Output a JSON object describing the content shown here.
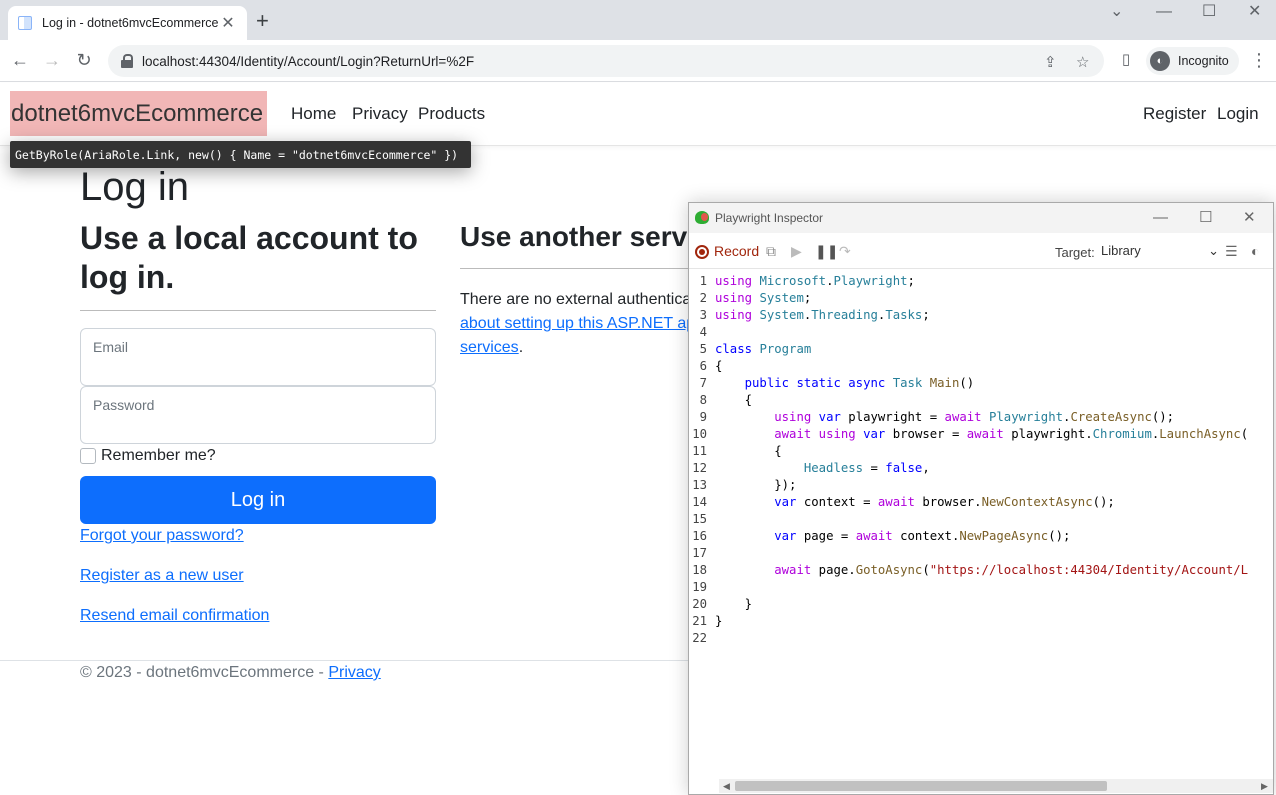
{
  "browser": {
    "tab_title": "Log in - dotnet6mvcEcommerce",
    "tab_close": "✕",
    "new_tab": "+",
    "url": "localhost:44304/Identity/Account/Login?ReturnUrl=%2F",
    "profile_label": "Incognito",
    "win_controls": [
      "⌄",
      "—",
      "☐",
      "✕"
    ],
    "nav_icons": [
      "arrow-back-icon",
      "arrow-forward-icon",
      "reload-icon"
    ]
  },
  "site": {
    "brand": "dotnet6mvcEcommerce",
    "nav": {
      "home": "Home",
      "privacy": "Privacy",
      "products": "Products",
      "register": "Register",
      "login": "Login"
    },
    "highlight_tooltip": "GetByRole(AriaRole.Link, new() { Name = \"dotnet6mvcEcommerce\" })"
  },
  "login": {
    "title": "Log in",
    "subtitle": "Use a local account to log in.",
    "email_label": "Email",
    "password_label": "Password",
    "remember_label": "Remember me?",
    "submit_label": "Log in",
    "forgot_link": "Forgot your password?",
    "register_link": "Register as a new user",
    "resend_link": "Resend email confirmation"
  },
  "external": {
    "title": "Use another servic",
    "text_line1": "There are no external authentica",
    "link_line2": "about setting up this ASP.NET ap",
    "link_line3": "services",
    "line3_suffix": "."
  },
  "footer": {
    "copyright": "© 2023 - dotnet6mvcEcommerce - ",
    "privacy_link": "Privacy"
  },
  "inspector": {
    "title": "Playwright Inspector",
    "record_label": "Record",
    "target_label": "Target:",
    "target_value": "Library",
    "code_lines": [
      [
        [
          "kw",
          "using"
        ],
        [
          "ct",
          " "
        ],
        [
          "ty",
          "Microsoft"
        ],
        [
          "ct",
          "."
        ],
        [
          "ty",
          "Playwright"
        ],
        [
          "ct",
          ";"
        ]
      ],
      [
        [
          "kw",
          "using"
        ],
        [
          "ct",
          " "
        ],
        [
          "ty",
          "System"
        ],
        [
          "ct",
          ";"
        ]
      ],
      [
        [
          "kw",
          "using"
        ],
        [
          "ct",
          " "
        ],
        [
          "ty",
          "System"
        ],
        [
          "ct",
          "."
        ],
        [
          "ty",
          "Threading"
        ],
        [
          "ct",
          "."
        ],
        [
          "ty",
          "Tasks"
        ],
        [
          "ct",
          ";"
        ]
      ],
      [],
      [
        [
          "kb",
          "class"
        ],
        [
          "ct",
          " "
        ],
        [
          "ty",
          "Program"
        ]
      ],
      [
        [
          "ct",
          "{"
        ]
      ],
      [
        [
          "ct",
          "    "
        ],
        [
          "kb",
          "public"
        ],
        [
          "ct",
          " "
        ],
        [
          "kb",
          "static"
        ],
        [
          "ct",
          " "
        ],
        [
          "kb",
          "async"
        ],
        [
          "ct",
          " "
        ],
        [
          "ty",
          "Task"
        ],
        [
          "ct",
          " "
        ],
        [
          "fn",
          "Main"
        ],
        [
          "ct",
          "()"
        ]
      ],
      [
        [
          "ct",
          "    {"
        ]
      ],
      [
        [
          "ct",
          "        "
        ],
        [
          "kw",
          "using"
        ],
        [
          "ct",
          " "
        ],
        [
          "kb",
          "var"
        ],
        [
          "ct",
          " playwright = "
        ],
        [
          "kw",
          "await"
        ],
        [
          "ct",
          " "
        ],
        [
          "ty",
          "Playwright"
        ],
        [
          "ct",
          "."
        ],
        [
          "fn",
          "CreateAsync"
        ],
        [
          "ct",
          "();"
        ]
      ],
      [
        [
          "ct",
          "        "
        ],
        [
          "kw",
          "await"
        ],
        [
          "ct",
          " "
        ],
        [
          "kw",
          "using"
        ],
        [
          "ct",
          " "
        ],
        [
          "kb",
          "var"
        ],
        [
          "ct",
          " browser = "
        ],
        [
          "kw",
          "await"
        ],
        [
          "ct",
          " playwright."
        ],
        [
          "ty",
          "Chromium"
        ],
        [
          "ct",
          "."
        ],
        [
          "fn",
          "LaunchAsync"
        ],
        [
          "ct",
          "("
        ]
      ],
      [
        [
          "ct",
          "        {"
        ]
      ],
      [
        [
          "ct",
          "            "
        ],
        [
          "ty",
          "Headless"
        ],
        [
          "ct",
          " = "
        ],
        [
          "kb",
          "false"
        ],
        [
          "ct",
          ","
        ]
      ],
      [
        [
          "ct",
          "        });"
        ]
      ],
      [
        [
          "ct",
          "        "
        ],
        [
          "kb",
          "var"
        ],
        [
          "ct",
          " context = "
        ],
        [
          "kw",
          "await"
        ],
        [
          "ct",
          " browser."
        ],
        [
          "fn",
          "NewContextAsync"
        ],
        [
          "ct",
          "();"
        ]
      ],
      [],
      [
        [
          "ct",
          "        "
        ],
        [
          "kb",
          "var"
        ],
        [
          "ct",
          " page = "
        ],
        [
          "kw",
          "await"
        ],
        [
          "ct",
          " context."
        ],
        [
          "fn",
          "NewPageAsync"
        ],
        [
          "ct",
          "();"
        ]
      ],
      [],
      [
        [
          "ct",
          "        "
        ],
        [
          "kw",
          "await"
        ],
        [
          "ct",
          " page."
        ],
        [
          "fn",
          "GotoAsync"
        ],
        [
          "ct",
          "("
        ],
        [
          "st",
          "\"https://localhost:44304/Identity/Account/L"
        ]
      ],
      [],
      [
        [
          "ct",
          "    }"
        ]
      ],
      [
        [
          "ct",
          "}"
        ]
      ],
      []
    ]
  }
}
